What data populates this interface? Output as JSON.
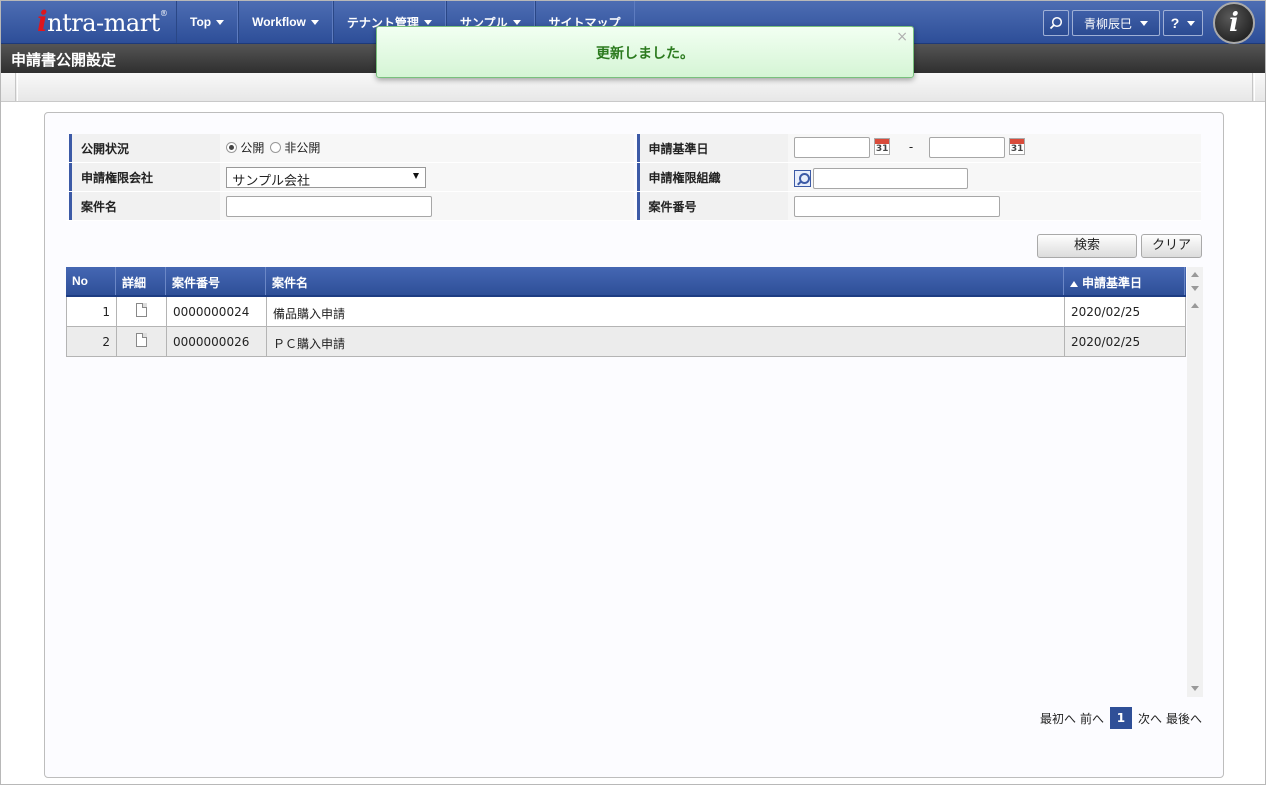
{
  "navbar": {
    "logo_mark": "i",
    "logo_text": "ntra-mart",
    "logo_reg": "®",
    "menu": [
      {
        "label": "Top"
      },
      {
        "label": "Workflow"
      },
      {
        "label": "テナント管理"
      },
      {
        "label": "サンプル"
      },
      {
        "label": "サイトマップ"
      }
    ],
    "search_icon": "magnifier-icon",
    "user_name": "青柳辰巳",
    "help_label": "?",
    "brand_badge": "i"
  },
  "page": {
    "title": "申請書公開設定"
  },
  "toast": {
    "message": "更新しました。",
    "close": "×"
  },
  "form": {
    "status": {
      "label": "公開状況",
      "option_public": "公開",
      "option_private": "非公開",
      "selected": "公開"
    },
    "base_date": {
      "label": "申請基準日",
      "from": "",
      "to": "",
      "separator": "-",
      "calendar_day": "31"
    },
    "company": {
      "label": "申請権限会社",
      "selected": "サンプル会社"
    },
    "organization": {
      "label": "申請権限組織",
      "value": ""
    },
    "matter_name": {
      "label": "案件名",
      "value": ""
    },
    "matter_number": {
      "label": "案件番号",
      "value": ""
    },
    "search_button": "検索",
    "clear_button": "クリア"
  },
  "table": {
    "headers": {
      "no": "No",
      "detail": "詳細",
      "matter_number": "案件番号",
      "matter_name": "案件名",
      "base_date": "申請基準日"
    },
    "rows": [
      {
        "no": "1",
        "matter_number": "0000000024",
        "matter_name": "備品購入申請",
        "base_date": "2020/02/25"
      },
      {
        "no": "2",
        "matter_number": "0000000026",
        "matter_name": "ＰＣ購入申請",
        "base_date": "2020/02/25"
      }
    ]
  },
  "pager": {
    "first": "最初へ",
    "prev": "前へ",
    "current": "1",
    "next": "次へ",
    "last": "最後へ"
  }
}
